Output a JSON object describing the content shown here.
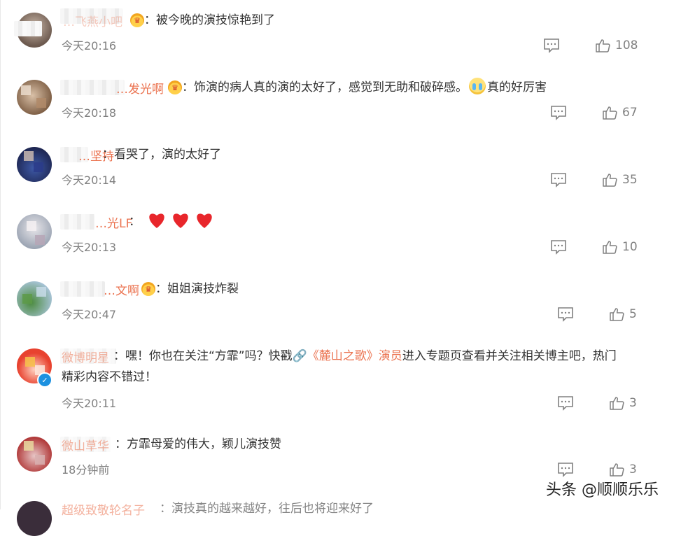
{
  "comments": [
    {
      "name": "…飞燕小吧",
      "text": "被今晚的演技惊艳到了",
      "time": "今天20:16",
      "likes": "108"
    },
    {
      "name": "…发光啊",
      "text": "饰演的病人真的演的太好了，感觉到无助和破碎感。",
      "text_after": "真的好厉害",
      "time": "今天20:18",
      "likes": "67"
    },
    {
      "name": "…坚持",
      "text": "看哭了，演的太好了",
      "time": "今天20:14",
      "likes": "35"
    },
    {
      "name": "…光LF",
      "text": "",
      "time": "今天20:13",
      "likes": "10",
      "hearts": 3
    },
    {
      "name": "…文啊",
      "text": "姐姐演技炸裂",
      "time": "今天20:47",
      "likes": "5"
    },
    {
      "name": "微博明星",
      "text_pre": "嘿！你也在关注“方霏”吗？快戳",
      "link": "《麓山之歌》演员",
      "text_post": "进入专题页查看并关注相关博主吧，热门",
      "text_line2": "精彩内容不错过！",
      "time": "今天20:11",
      "likes": "3"
    },
    {
      "name": "微山草华",
      "text": "方霏母爱的伟大，颖儿演技赞",
      "time": "18分钟前",
      "likes": "3"
    }
  ],
  "last_partial": {
    "name": "超级致敬轮名子",
    "text": "演技真的越来越好，往后也将迎来好了"
  },
  "watermark": "头条 @顺顺乐乐",
  "colors": {
    "name": "#eb7350",
    "time": "#808080",
    "text": "#333333"
  },
  "icons": {
    "reply": "comment-icon",
    "like": "thumbs-up-icon",
    "crown": "crown-badge-icon",
    "verified": "verified-icon",
    "heart": "red-heart-emoji",
    "cry": "crying-emoji"
  }
}
